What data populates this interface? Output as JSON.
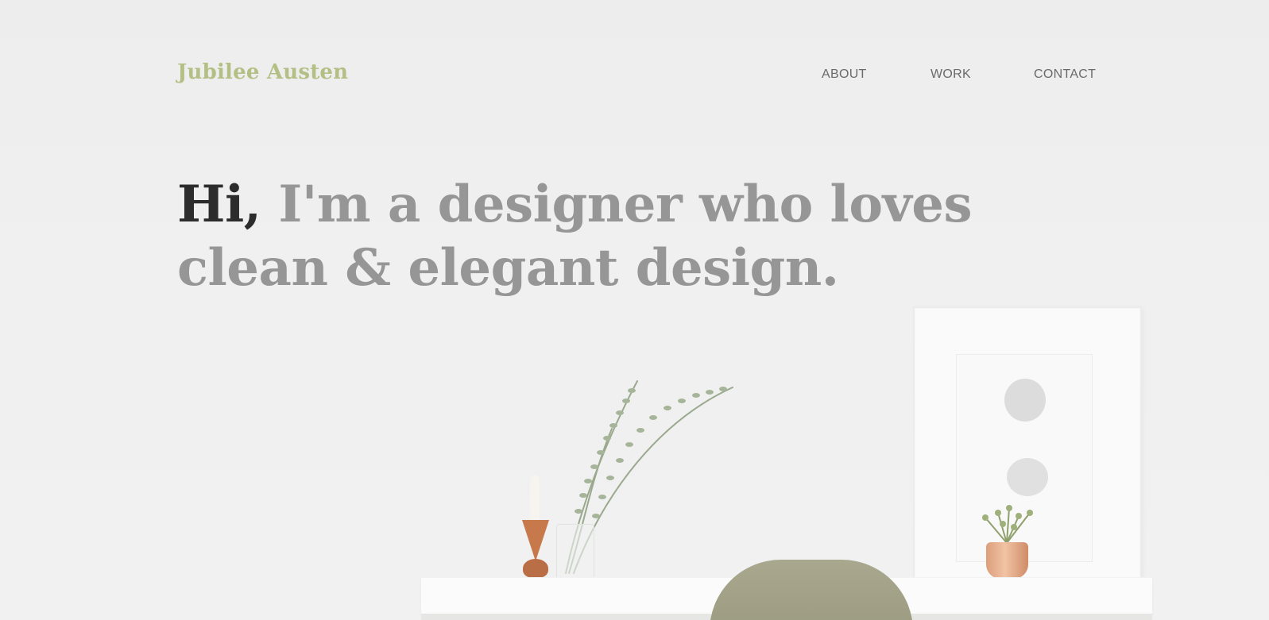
{
  "header": {
    "brand": "Jubilee Austen",
    "nav": [
      {
        "label": "ABOUT"
      },
      {
        "label": "WORK"
      },
      {
        "label": "CONTACT"
      }
    ]
  },
  "hero": {
    "greeting": "Hi,",
    "line1_rest": " I'm a designer who loves",
    "line2": "clean & elegant design."
  },
  "colors": {
    "brand": "#b3bf84",
    "nav_text": "#6a6a6a",
    "headline_dark": "#2c2c2c",
    "headline_muted": "#969696",
    "background": "#efefef"
  }
}
